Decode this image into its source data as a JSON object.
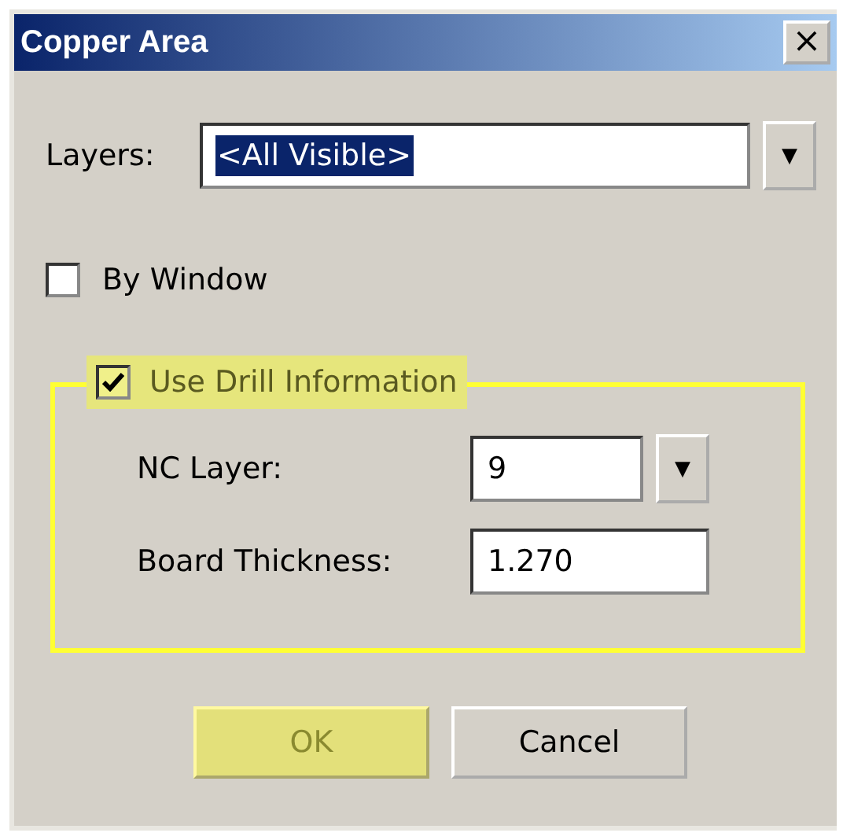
{
  "window": {
    "title": "Copper Area",
    "close": "×"
  },
  "layers": {
    "label": "Layers:",
    "value": "<All Visible>",
    "value_selected": true,
    "dropdown": "▼"
  },
  "by_window": {
    "label": "By Window",
    "checked": false
  },
  "drill_group": {
    "label": "Use Drill Information",
    "checked": true,
    "highlighted": true,
    "fields": [
      {
        "kind": "combo",
        "label": "NC Layer:",
        "value": "9",
        "dropdown": "▼"
      },
      {
        "kind": "text",
        "label": "Board Thickness:",
        "value": "1.270"
      }
    ]
  },
  "buttons": [
    {
      "label": "OK",
      "highlighted": true
    },
    {
      "label": "Cancel",
      "highlighted": false
    }
  ]
}
